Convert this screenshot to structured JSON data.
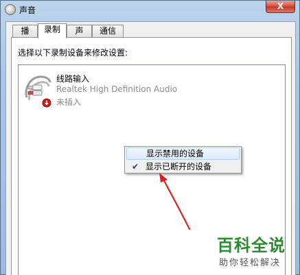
{
  "window": {
    "title": "声音",
    "close_label": "X"
  },
  "tabs": [
    {
      "label": "播放",
      "active": false
    },
    {
      "label": "录制",
      "active": true
    },
    {
      "label": "声音",
      "active": false
    },
    {
      "label": "通信",
      "active": false
    }
  ],
  "panel": {
    "instruction": "选择以下录制设备来修改设置:"
  },
  "devices": [
    {
      "name": "线路输入",
      "description": "Realtek High Definition Audio",
      "status": "未插入",
      "icon": "rca-audio-cable-icon",
      "badge_icon": "unplugged-status-icon"
    }
  ],
  "context_menu": {
    "items": [
      {
        "label": "显示禁用的设备",
        "checked": false,
        "highlighted": true
      },
      {
        "label": "显示已断开的设备",
        "checked": true,
        "highlighted": false
      }
    ],
    "check_glyph": "✔"
  },
  "annotation": {
    "color": "#d62020"
  },
  "watermark": {
    "title": "百科全说",
    "subtitle": "助你轻松解决"
  },
  "colors": {
    "accent": "#aecff7",
    "watermark": "#2d8a2f"
  }
}
